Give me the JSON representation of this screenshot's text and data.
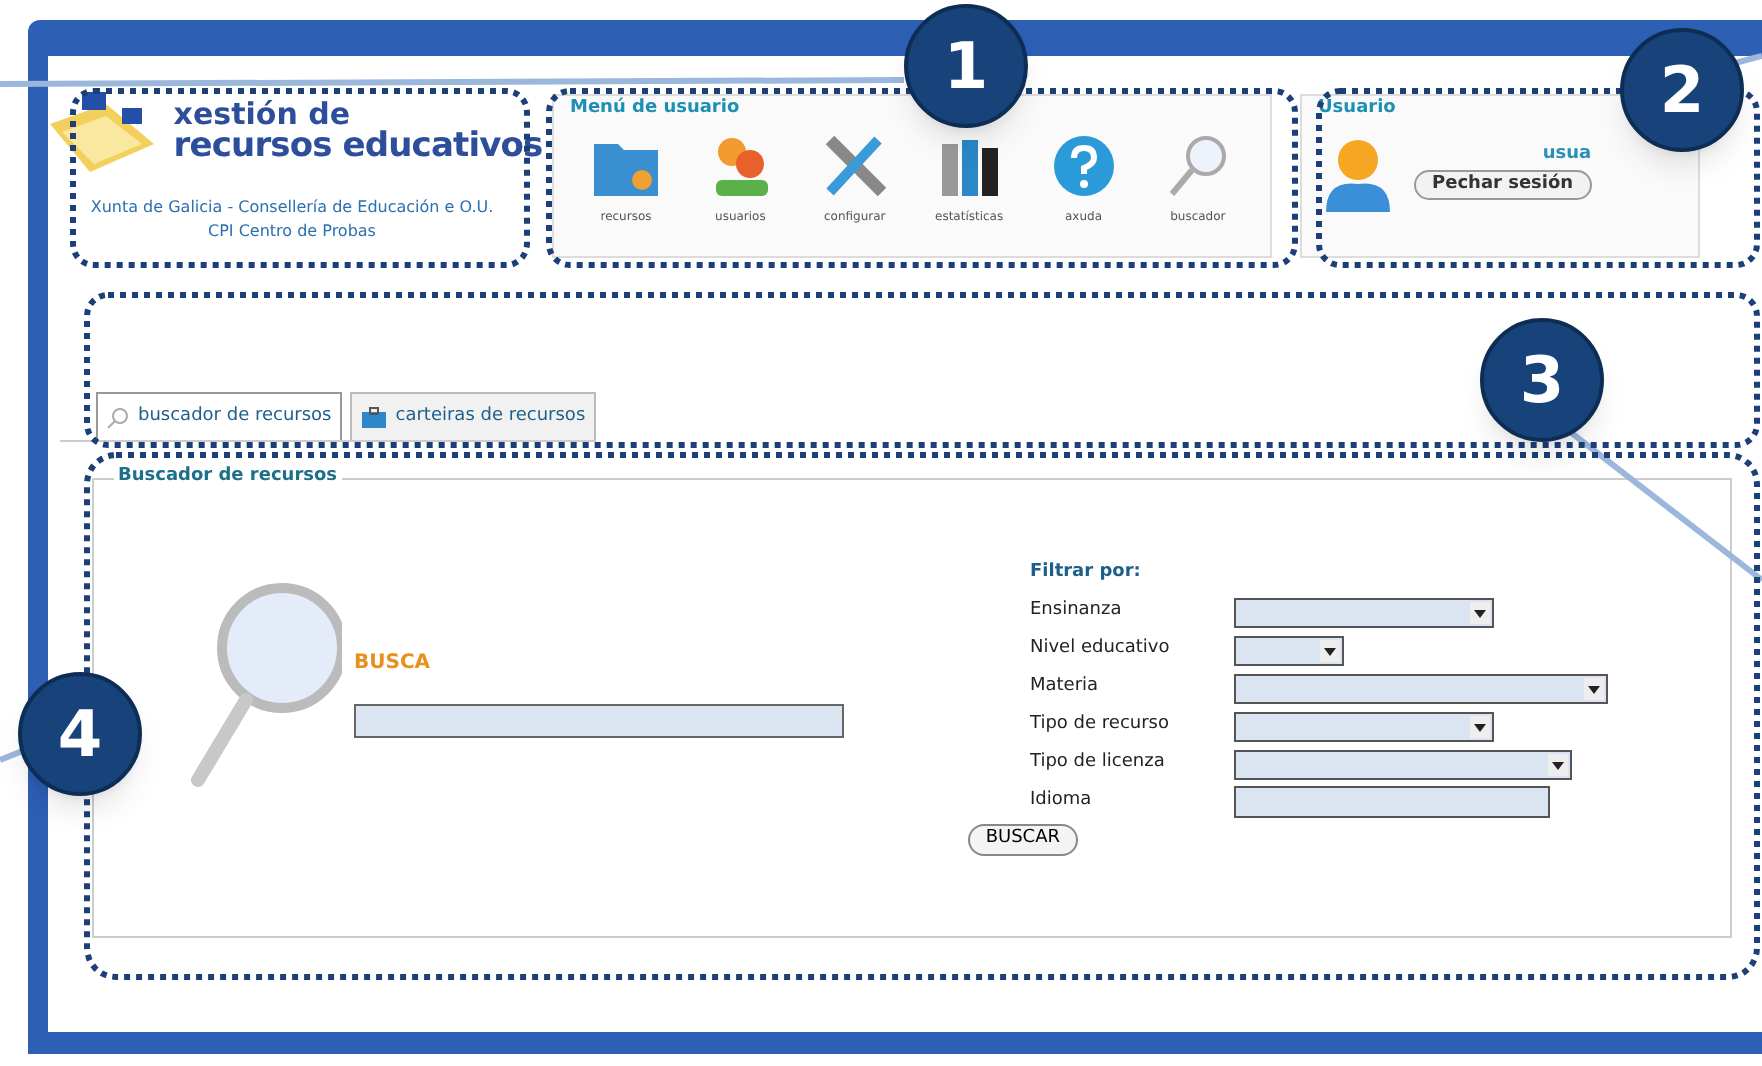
{
  "header": {
    "logo_line1": "xestión de",
    "logo_line2": "recursos educativos",
    "org": "Xunta de Galicia - Consellería de Educación e O.U.",
    "center": "CPI Centro de Probas"
  },
  "user_menu": {
    "title": "Menú de usuario",
    "items": [
      {
        "label": "recursos",
        "kind": "folder"
      },
      {
        "label": "usuarios",
        "kind": "users"
      },
      {
        "label": "configurar",
        "kind": "tools"
      },
      {
        "label": "estatísticas",
        "kind": "stats"
      },
      {
        "label": "axuda",
        "kind": "help"
      },
      {
        "label": "buscador",
        "kind": "search"
      }
    ]
  },
  "user_panel": {
    "title": "Usuario",
    "name": "usua",
    "logout": "Pechar sesión"
  },
  "tabs": [
    {
      "label": "buscador de recursos",
      "selected": true,
      "kind": "search"
    },
    {
      "label": "carteiras de recursos",
      "selected": false,
      "kind": "briefcase"
    }
  ],
  "search_panel": {
    "legend": "Buscador de recursos",
    "search_label": "BUSCA",
    "filter_title": "Filtrar por:",
    "button": "BUSCAR",
    "filters": [
      {
        "label": "Ensinanza",
        "kind": "select"
      },
      {
        "label": "Nivel educativo",
        "kind": "select"
      },
      {
        "label": "Materia",
        "kind": "select"
      },
      {
        "label": "Tipo de recurso",
        "kind": "select"
      },
      {
        "label": "Tipo de licenza",
        "kind": "select"
      },
      {
        "label": "Idioma",
        "kind": "text"
      }
    ]
  },
  "callouts": [
    "1",
    "2",
    "3",
    "4"
  ]
}
